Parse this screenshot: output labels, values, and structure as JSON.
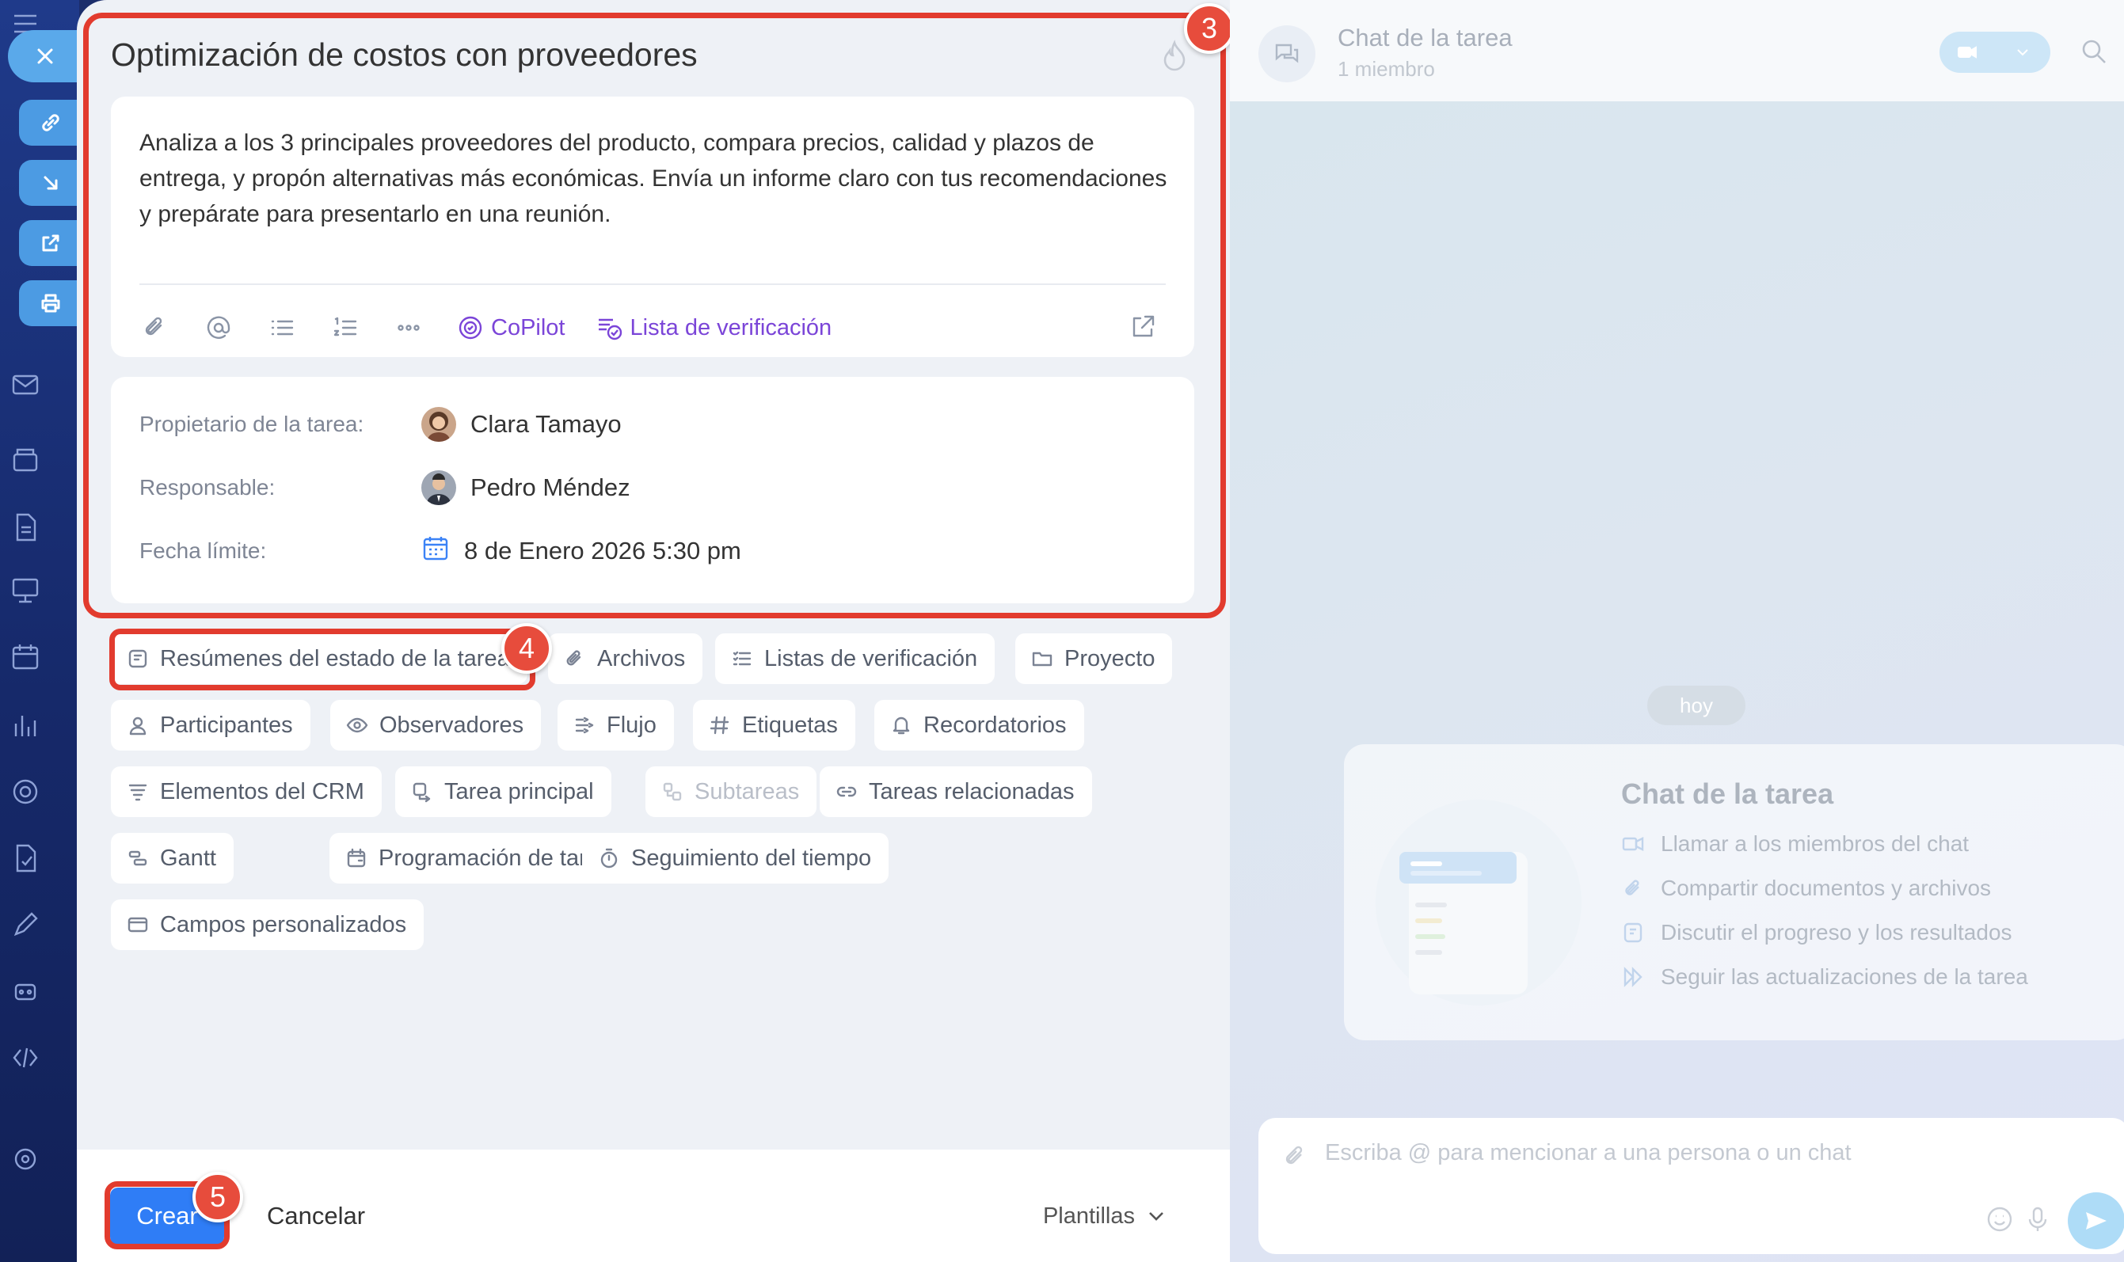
{
  "task": {
    "title": "Optimización de costos con proveedores",
    "description": "Analiza a los 3 principales proveedores del producto, compara precios, calidad y plazos de entrega, y propón alternativas más económicas. Envía un informe claro con tus recomendaciones y prepárate para presentarlo en una reunión.",
    "toolbar": {
      "icons": [
        "paperclip-icon",
        "mention-icon",
        "bulleted-list-icon",
        "numbered-list-icon",
        "more-icon",
        "expand-icon"
      ],
      "copilot_label": "CoPilot",
      "checklist_label": "Lista de verificación"
    },
    "meta": {
      "owner_label": "Propietario de la tarea:",
      "owner_name": "Clara Tamayo",
      "assignee_label": "Responsable:",
      "assignee_name": "Pedro Méndez",
      "deadline_label": "Fecha límite:",
      "deadline_value": "8 de Enero 2026 5:30 pm"
    }
  },
  "chips": [
    {
      "label": "Resúmenes del estado de la tarea",
      "icon": "summary-icon"
    },
    {
      "label": "Archivos",
      "icon": "paperclip-icon"
    },
    {
      "label": "Listas de verificación",
      "icon": "checklist-icon"
    },
    {
      "label": "Proyecto",
      "icon": "folder-icon"
    },
    {
      "label": "Participantes",
      "icon": "person-icon"
    },
    {
      "label": "Observadores",
      "icon": "eye-icon"
    },
    {
      "label": "Flujo",
      "icon": "flow-icon"
    },
    {
      "label": "Etiquetas",
      "icon": "hashtag-icon"
    },
    {
      "label": "Recordatorios",
      "icon": "bell-icon"
    },
    {
      "label": "Elementos del CRM",
      "icon": "crm-icon"
    },
    {
      "label": "Tarea principal",
      "icon": "parent-task-icon"
    },
    {
      "label": "Subtareas",
      "icon": "subtasks-icon"
    },
    {
      "label": "Tareas relacionadas",
      "icon": "link-icon"
    },
    {
      "label": "Gantt",
      "icon": "gantt-icon"
    },
    {
      "label": "Programación de tareas",
      "icon": "calendar-schedule-icon"
    },
    {
      "label": "Seguimiento del tiempo",
      "icon": "stopwatch-icon"
    },
    {
      "label": "Campos personalizados",
      "icon": "custom-fields-icon"
    }
  ],
  "footer": {
    "create_label": "Crear",
    "cancel_label": "Cancelar",
    "templates_label": "Plantillas"
  },
  "annotations": {
    "badge_3": "3",
    "badge_4": "4",
    "badge_5": "5"
  },
  "chat": {
    "title": "Chat de la tarea",
    "subtitle": "1 miembro",
    "today_label": "hoy",
    "info_title": "Chat de la tarea",
    "info_items": [
      {
        "label": "Llamar a los miembros del chat",
        "icon": "video-icon"
      },
      {
        "label": "Compartir documentos y archivos",
        "icon": "paperclip-icon"
      },
      {
        "label": "Discutir el progreso y los resultados",
        "icon": "comment-icon"
      },
      {
        "label": "Seguir las actualizaciones de la tarea",
        "icon": "forward-icon"
      }
    ],
    "composer_placeholder": "Escriba @ para mencionar a una persona o un chat"
  },
  "colors": {
    "accent": "#2f7df6",
    "annotation": "#e23b2e",
    "copilot": "#7b45d8",
    "nav_bg": "#1b2d6b"
  }
}
